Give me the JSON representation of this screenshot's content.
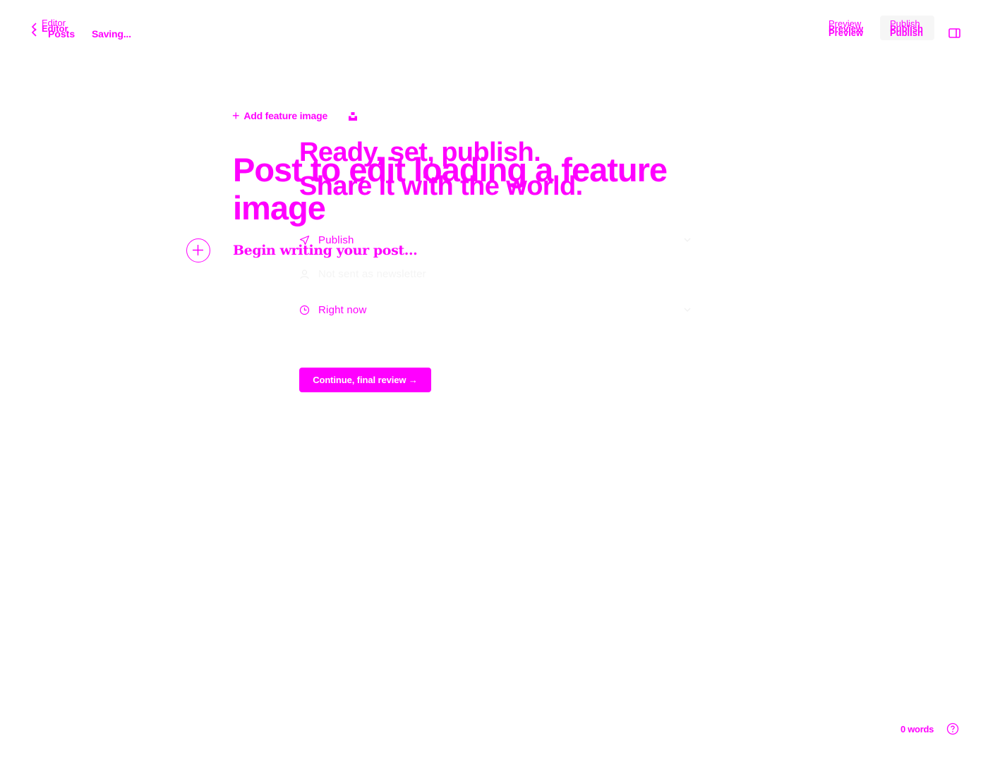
{
  "header": {
    "back_label_top": "Editor",
    "back_label_mid": "Editor",
    "back_label_parent": "Posts",
    "save_status": "Saving...",
    "preview_top": "Preview",
    "preview_mid": "Preview",
    "preview_bottom": "Preview",
    "publish_top": "Publish",
    "publish_mid": "Publish",
    "publish_bottom": "Publish"
  },
  "editor": {
    "add_feature_image": "Add feature image",
    "title": "Post to edit loading a feature image",
    "body_placeholder": "Begin writing your post..."
  },
  "publish_flow": {
    "heading_line1": "Ready, set, publish.",
    "heading_line2": "Share it with the world.",
    "rows": [
      {
        "label": "Publish",
        "icon": "send-icon"
      },
      {
        "label": "Not sent as newsletter",
        "icon": "person-icon"
      },
      {
        "label": "Right now",
        "icon": "clock-icon"
      }
    ],
    "continue_label": "Continue, final review →"
  },
  "footer": {
    "word_count": "0 words"
  },
  "colors": {
    "accent": "#ff00ff",
    "background": "#ffffff",
    "button_text": "#ffffff",
    "publish_button_bg": "#f6f6f6"
  }
}
